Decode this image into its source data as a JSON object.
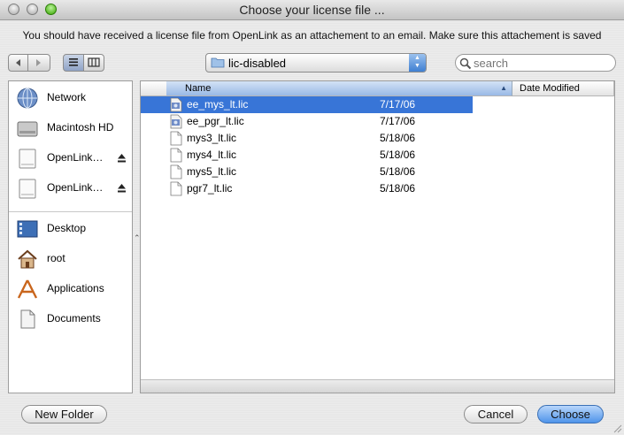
{
  "window": {
    "title": "Choose your license file ..."
  },
  "message": "You should have received a license file from OpenLink as an attachement to an email. Make sure this attachement is saved",
  "toolbar": {
    "back_icon": "chevron-left-icon",
    "forward_icon": "chevron-right-icon",
    "list_view_icon": "list-view-icon",
    "column_view_icon": "column-view-icon",
    "location": "lic-disabled",
    "search_placeholder": "search"
  },
  "sidebar": {
    "devices": [
      {
        "label": "Network",
        "icon": "network-globe-icon"
      },
      {
        "label": "Macintosh HD",
        "icon": "hard-drive-icon"
      },
      {
        "label": "OpenLink…",
        "icon": "disk-image-icon",
        "eject": true
      },
      {
        "label": "OpenLink…",
        "icon": "disk-image-icon",
        "eject": true
      }
    ],
    "places": [
      {
        "label": "Desktop",
        "icon": "desktop-icon"
      },
      {
        "label": "root",
        "icon": "home-icon"
      },
      {
        "label": "Applications",
        "icon": "applications-icon"
      },
      {
        "label": "Documents",
        "icon": "documents-icon"
      }
    ]
  },
  "file_list": {
    "columns": {
      "name": "Name",
      "date": "Date Modified"
    },
    "sort_column": "Name",
    "rows": [
      {
        "name": "ee_mys_lt.lic",
        "date": "7/17/06",
        "icon": "license-file-icon",
        "selected": true
      },
      {
        "name": "ee_pgr_lt.lic",
        "date": "7/17/06",
        "icon": "license-file-icon",
        "selected": false
      },
      {
        "name": "mys3_lt.lic",
        "date": "5/18/06",
        "icon": "document-icon",
        "selected": false
      },
      {
        "name": "mys4_lt.lic",
        "date": "5/18/06",
        "icon": "document-icon",
        "selected": false
      },
      {
        "name": "mys5_lt.lic",
        "date": "5/18/06",
        "icon": "document-icon",
        "selected": false
      },
      {
        "name": "pgr7_lt.lic",
        "date": "5/18/06",
        "icon": "document-icon",
        "selected": false
      }
    ]
  },
  "buttons": {
    "new_folder": "New Folder",
    "cancel": "Cancel",
    "choose": "Choose"
  },
  "colors": {
    "selection": "#3875d7",
    "primary_button": "#4f94ea"
  }
}
